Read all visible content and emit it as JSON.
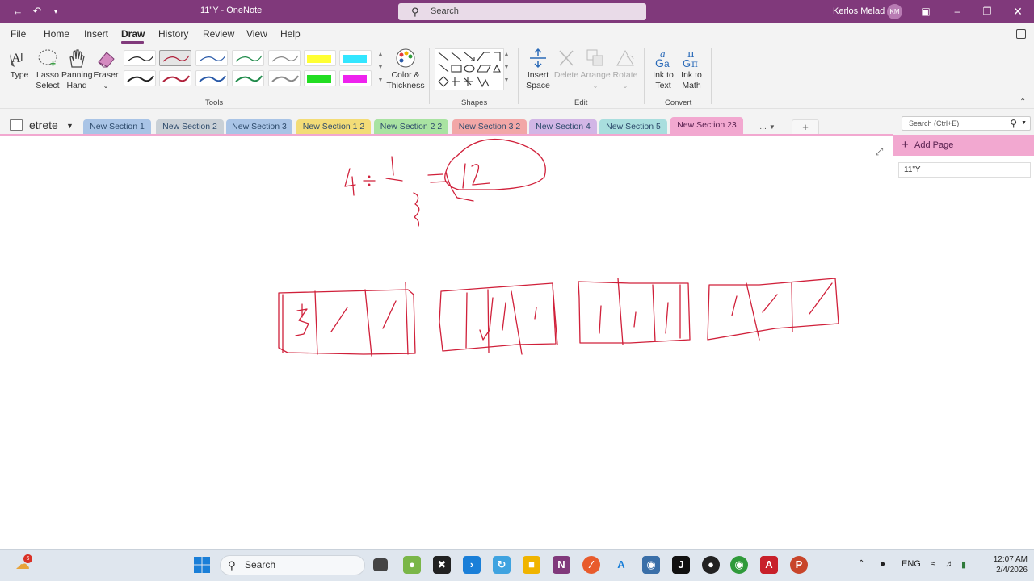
{
  "titlebar": {
    "doc_title": "11\"Y - OneNote",
    "search_placeholder": "Search",
    "user_name": "Kerlos Melad",
    "user_initials": "KM",
    "accent": "#80397b"
  },
  "menu": {
    "items": [
      "File",
      "Home",
      "Insert",
      "Draw",
      "History",
      "Review",
      "View",
      "Help"
    ],
    "active": "Draw"
  },
  "ribbon": {
    "tools": {
      "type": "Type",
      "lasso_1": "Lasso",
      "lasso_2": "Select",
      "panning_1": "Panning",
      "panning_2": "Hand",
      "eraser": "Eraser",
      "color_1": "Color &",
      "color_2": "Thickness",
      "label": "Tools"
    },
    "shapes_label": "Shapes",
    "edit": {
      "insert_1": "Insert",
      "insert_2": "Space",
      "delete": "Delete",
      "arrange": "Arrange",
      "rotate": "Rotate",
      "label": "Edit"
    },
    "convert": {
      "ink_text_1": "Ink to",
      "ink_text_2": "Text",
      "ink_math_1": "Ink to",
      "ink_math_2": "Math",
      "label": "Convert"
    },
    "pen_colors": [
      "#222222",
      "#b0203a",
      "#2a5aa8",
      "#1f8a4a",
      "#888888"
    ],
    "highlighter_colors": [
      "#ffff33",
      "#33e6ff",
      "#22dd22",
      "#ee22ee"
    ]
  },
  "notebook": {
    "name": "etrete"
  },
  "sections": [
    {
      "label": "New Section 1",
      "color": "#a9c4e6"
    },
    {
      "label": "New Section 2",
      "color": "#c9d0d6"
    },
    {
      "label": "New Section 3",
      "color": "#a9c4e6"
    },
    {
      "label": "New Section 1 2",
      "color": "#f3dc77"
    },
    {
      "label": "New Section 2 2",
      "color": "#a9e3a2"
    },
    {
      "label": "New Section 3 2",
      "color": "#f2a7a7"
    },
    {
      "label": "New Section 4",
      "color": "#d2b6e6"
    },
    {
      "label": "New Section 5",
      "color": "#a9dede"
    },
    {
      "label": "New Section 23",
      "color": "#f2a8d0"
    }
  ],
  "active_section": "New Section 23",
  "tabs_more": "...",
  "tabs_add": "+",
  "right_search_placeholder": "Search (Ctrl+E)",
  "pages": {
    "add_page": "Add Page",
    "items": [
      "11\"Y"
    ]
  },
  "taskbar": {
    "search_placeholder": "Search",
    "weather_badge": "6",
    "language": "ENG",
    "time": "12:07 AM",
    "date": "2/4/2026"
  }
}
